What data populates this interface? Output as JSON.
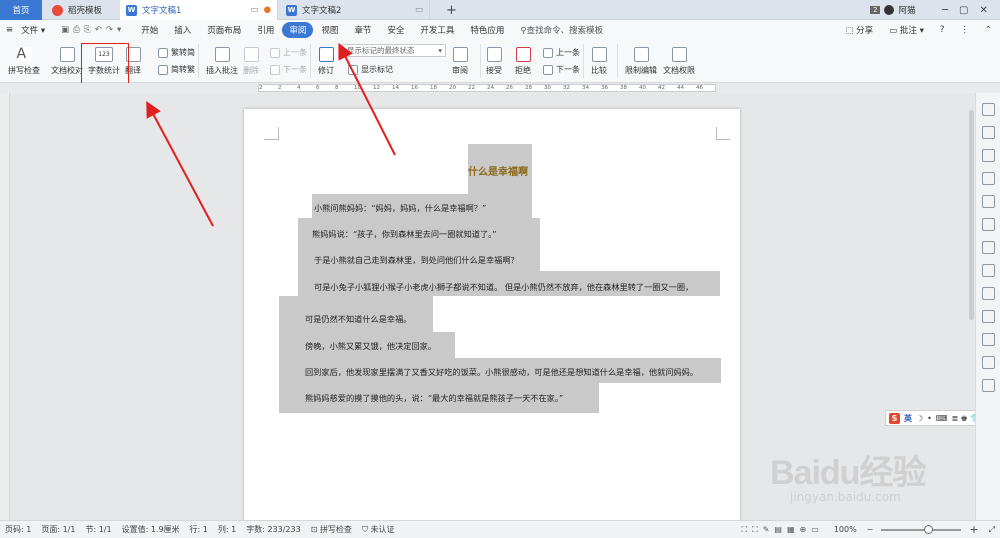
{
  "tabs": {
    "home": "首页",
    "daoke": "稻壳模板",
    "doc1": "文字文稿1",
    "doc2": "文字文稿2",
    "badge": "2",
    "user": "阿猫"
  },
  "menu": {
    "file": "文件",
    "items": [
      "开始",
      "插入",
      "页面布局",
      "引用",
      "审阅",
      "视图",
      "章节",
      "安全",
      "开发工具",
      "特色应用"
    ],
    "search": "查找命令、搜索模板",
    "share": "分享",
    "comment": "批注"
  },
  "ribbon": {
    "spell": "拼写检查",
    "proof": "文档校对",
    "wordcount": "字数统计",
    "translate": "翻译",
    "trad2simp": "繁转简",
    "simp2trad": "简转繁",
    "insert_comment": "插入批注",
    "delete": "删除",
    "prev": "上一条",
    "next": "下一条",
    "revise": "修订",
    "markup_state": "显示标记的最终状态",
    "show_markup": "显示标记",
    "review": "审阅",
    "accept": "接受",
    "reject": "拒绝",
    "prev2": "上一条",
    "next2": "下一条",
    "compare": "比较",
    "restrict": "限制编辑",
    "perm": "文档权限"
  },
  "ruler": [
    "2",
    "2",
    "4",
    "6",
    "8",
    "10",
    "12",
    "14",
    "16",
    "18",
    "20",
    "22",
    "24",
    "26",
    "28",
    "30",
    "32",
    "34",
    "36",
    "38",
    "40",
    "42",
    "44",
    "46"
  ],
  "doc": {
    "title": "什么是幸福啊",
    "lines": [
      "小熊问熊妈妈：“妈妈，妈妈，什么是幸福啊？”",
      "熊妈妈说：“孩子，你到森林里去问一圈就知道了。”",
      "于是小熊就自己走到森林里，到处问他们什么是幸福啊？",
      "可是小兔子小狐狸小猴子小老虎小狮子都说不知道。 但是小熊仍然不放弃，他在森林里转了一圈又一圈，",
      "可是仍然不知道什么是幸福。",
      "傍晚，小熊又累又饿，他决定回家。",
      "回到家后，他发现家里摆满了又香又好吃的饭菜。小熊很感动，可是他还是想知道什么是幸福，他就问妈妈。",
      "熊妈妈慈爱的摸了摸他的头，说：“最大的幸福就是熊孩子一天不在家。”"
    ]
  },
  "ime": {
    "label": "英"
  },
  "watermark": {
    "brand": "Baidu经验",
    "url": "jingyan.baidu.com"
  },
  "status": {
    "page_num": "页码: 1",
    "pages": "页面: 1/1",
    "section": "节: 1/1",
    "setting": "设置值: 1.9厘米",
    "row": "行: 1",
    "col": "列: 1",
    "wordcount": "字数: 233/233",
    "spell": "拼写检查",
    "auth": "未认证",
    "zoom": "100%"
  },
  "colors": {
    "accent": "#3a78d3",
    "highlight": "#c9c9c9",
    "arrow": "#e02020",
    "title": "#8a6a1a"
  }
}
